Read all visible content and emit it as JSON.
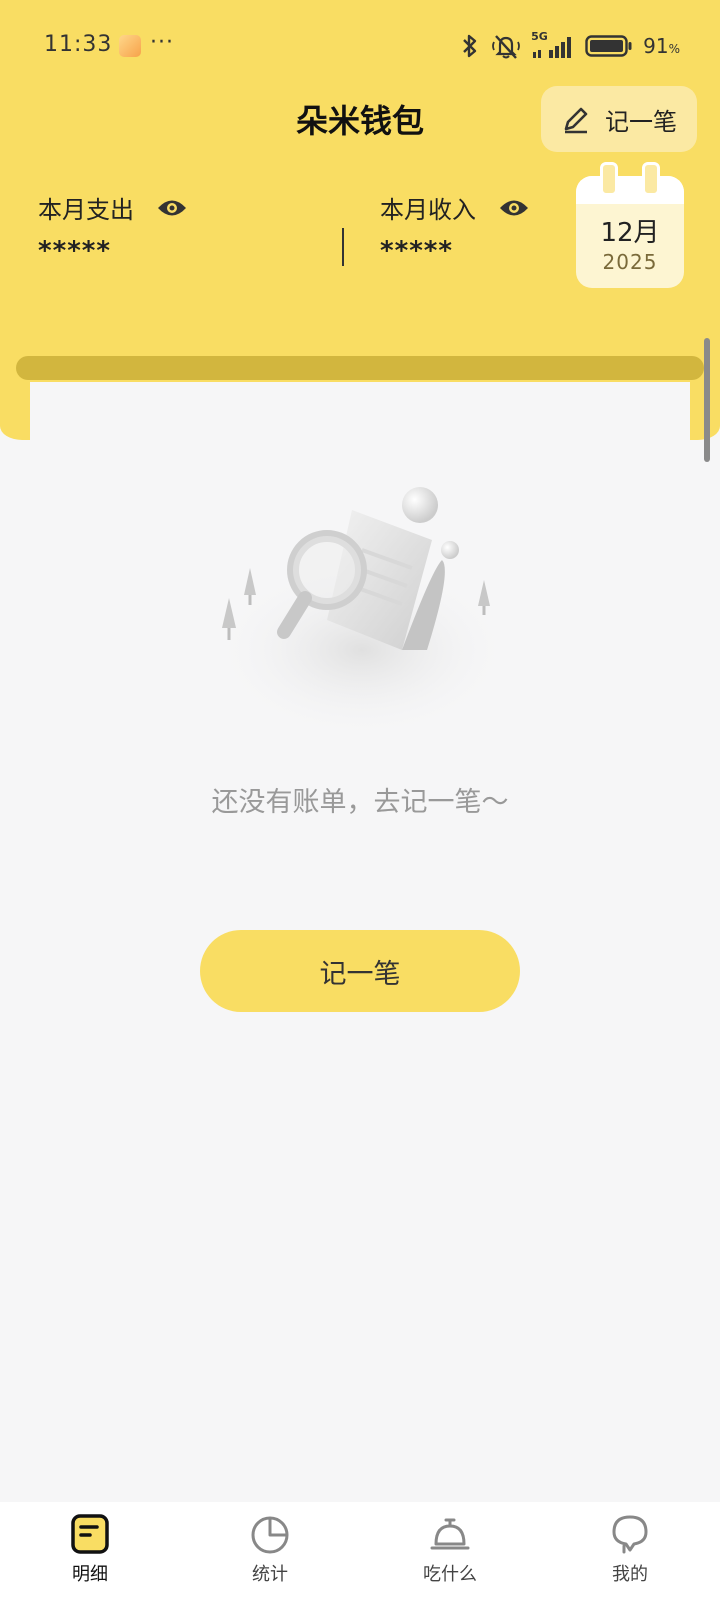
{
  "status_bar": {
    "time": "11:33",
    "more": "···",
    "battery": "91",
    "battery_unit": "%",
    "network": "5G"
  },
  "header": {
    "title": "朵米钱包",
    "record_button": "记一笔",
    "expense_label": "本月支出",
    "expense_value": "*****",
    "income_label": "本月收入",
    "income_value": "*****"
  },
  "calendar": {
    "month": "12月",
    "year": "2025"
  },
  "empty_state": {
    "message": "还没有账单，去记一笔～",
    "button": "记一笔"
  },
  "bottom_nav": {
    "items": [
      {
        "label": "明细",
        "icon": "bill-icon",
        "active": true
      },
      {
        "label": "统计",
        "icon": "pie-chart-icon",
        "active": false
      },
      {
        "label": "吃什么",
        "icon": "service-bell-icon",
        "active": false
      },
      {
        "label": "我的",
        "icon": "profile-icon",
        "active": false
      }
    ]
  },
  "colors": {
    "accent": "#f9dd63",
    "accent_dark": "#d2b63e",
    "background": "#f6f6f7"
  }
}
